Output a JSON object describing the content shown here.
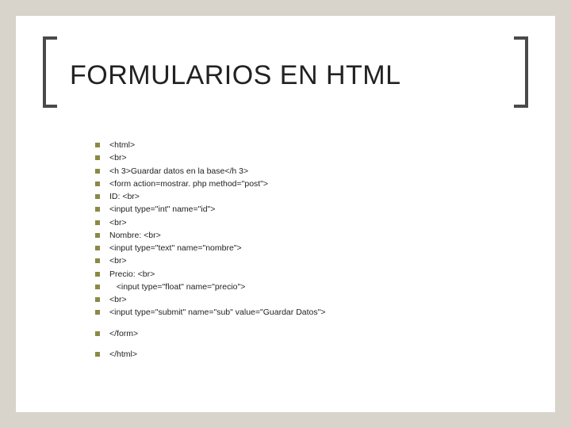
{
  "title": "FORMULARIOS EN HTML",
  "lines": {
    "l0": "<html>",
    "l1": "<br>",
    "l2": "<h 3>Guardar datos en la base</h 3>",
    "l3": "<form action=mostrar. php method=\"post\">",
    "l4": "ID: <br>",
    "l5": "<input type=\"int\" name=\"id\">",
    "l6": "<br>",
    "l7": "Nombre: <br>",
    "l8": "<input type=\"text\" name=\"nombre\">",
    "l9": "<br>",
    "l10": "Precio: <br>",
    "l11": "   <input type=\"float\" name=\"precio\">",
    "l12": "<br>",
    "l13": "<input type=\"submit\" name=\"sub\" value=\"Guardar Datos\">",
    "l14": "</form>",
    "l15": "</html>"
  }
}
